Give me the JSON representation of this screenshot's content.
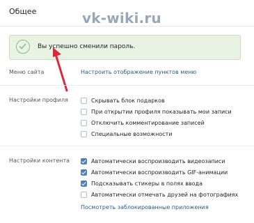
{
  "header": {
    "tab_title": "Общее",
    "watermark": "vk-wiki.ru"
  },
  "alert": {
    "text": "Вы успешно сменили пароль."
  },
  "menu": {
    "label": "Меню сайта",
    "link": "Настроить отображение пунктов меню"
  },
  "profile": {
    "label": "Настройки профиля",
    "options": [
      {
        "text": "Скрывать блок подарков",
        "checked": false
      },
      {
        "text": "При открытии профиля показывать мои записи",
        "checked": false
      },
      {
        "text": "Отключить комментирование записей",
        "checked": false
      },
      {
        "text": "Специальные возможности",
        "checked": false
      }
    ]
  },
  "content": {
    "label": "Настройки контента",
    "options": [
      {
        "text": "Автоматически воспроизводить видеозаписи",
        "checked": true
      },
      {
        "text": "Автоматически воспроизводить GIF-анимации",
        "checked": true
      },
      {
        "text": "Подсказывать стикеры в полях ввода",
        "checked": true
      },
      {
        "text": "Автоматически отмечать друзей на фотографиях",
        "checked": false
      }
    ],
    "link": "Посмотреть заблокированные приложения"
  },
  "colors": {
    "accent": "#5181b8",
    "link": "#2a5885",
    "alert_bg": "#e8f3e4",
    "arrow": "#d9283a"
  }
}
